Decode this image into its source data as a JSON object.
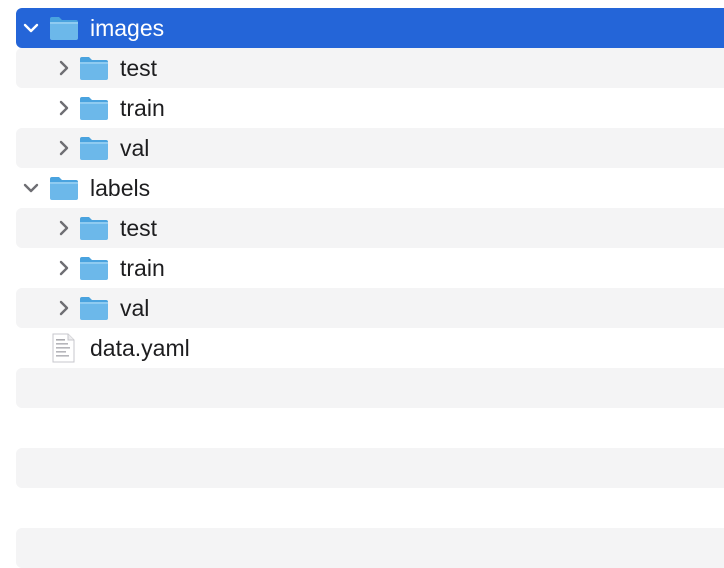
{
  "colors": {
    "selection": "#2465d8",
    "stripe": "#f4f4f5",
    "folder_body": "#6cb8ea",
    "folder_tab": "#4aa3df"
  },
  "rows": [
    {
      "name": "images",
      "icon": "folder-icon",
      "disclosure": "expanded",
      "selected": true
    },
    {
      "name": "test",
      "icon": "folder-icon",
      "disclosure": "collapsed"
    },
    {
      "name": "train",
      "icon": "folder-icon",
      "disclosure": "collapsed"
    },
    {
      "name": "val",
      "icon": "folder-icon",
      "disclosure": "collapsed"
    },
    {
      "name": "labels",
      "icon": "folder-icon",
      "disclosure": "expanded"
    },
    {
      "name": "test",
      "icon": "folder-icon",
      "disclosure": "collapsed"
    },
    {
      "name": "train",
      "icon": "folder-icon",
      "disclosure": "collapsed"
    },
    {
      "name": "val",
      "icon": "folder-icon",
      "disclosure": "collapsed"
    },
    {
      "name": "data.yaml",
      "icon": "yaml-file-icon",
      "disclosure": "none"
    }
  ]
}
